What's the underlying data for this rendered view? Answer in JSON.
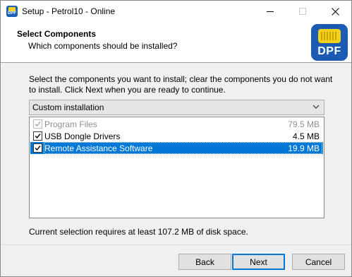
{
  "window": {
    "title": "Setup - Petrol10 - Online",
    "app_icon_text": "DPF"
  },
  "header": {
    "title": "Select Components",
    "subtitle": "Which components should be installed?",
    "logo_text": "DPF"
  },
  "body": {
    "description": "Select the components you want to install; clear the components you do not want to install. Click Next when you are ready to continue.",
    "install_type": {
      "selected": "Custom installation"
    },
    "components": [
      {
        "label": "Program Files",
        "size": "79.5 MB",
        "checked": true,
        "enabled": false,
        "selected": false
      },
      {
        "label": "USB Dongle Drivers",
        "size": "4.5 MB",
        "checked": true,
        "enabled": true,
        "selected": false
      },
      {
        "label": "Remote Assistance Software",
        "size": "19.9 MB",
        "checked": true,
        "enabled": true,
        "selected": true
      }
    ],
    "space_required": "Current selection requires at least 107.2 MB of disk space."
  },
  "buttons": {
    "back": "Back",
    "next": "Next",
    "cancel": "Cancel"
  },
  "colors": {
    "selection": "#0078d7",
    "logo_blue": "#1b5bb3",
    "logo_yellow": "#f2d31a"
  }
}
